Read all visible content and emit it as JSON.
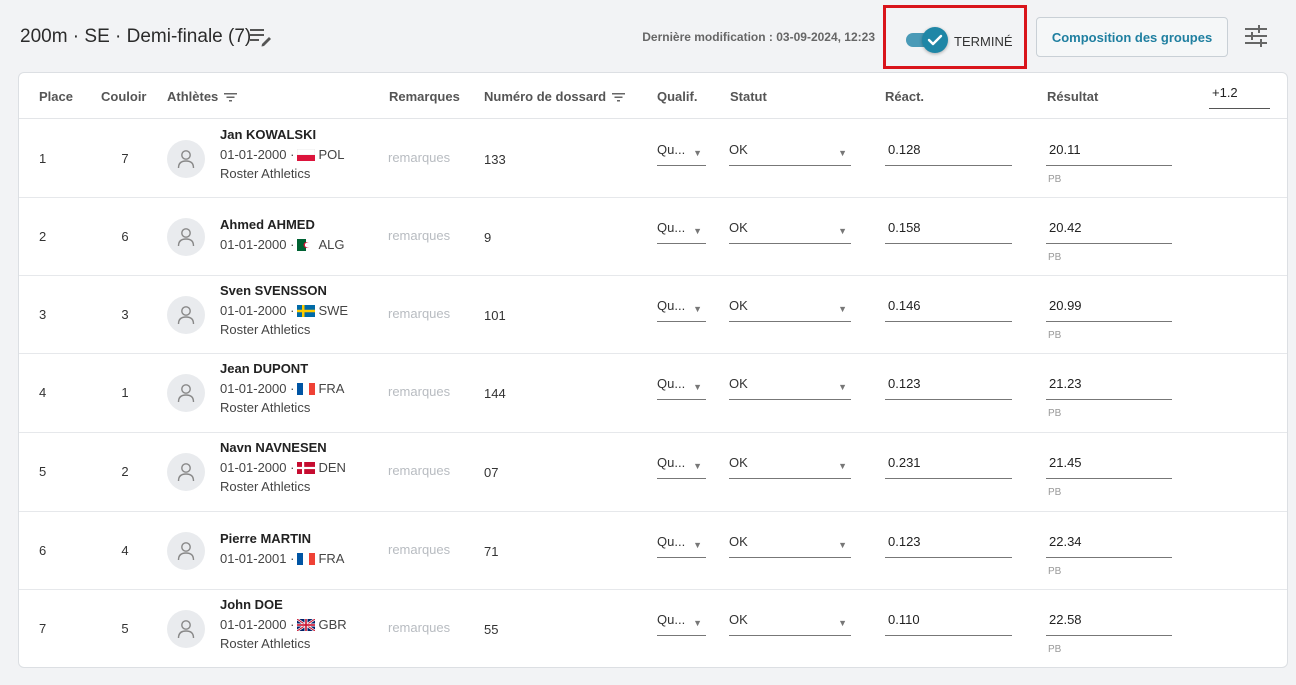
{
  "header": {
    "title": "200m · SE · Demi-finale (7)",
    "last_modified": "Dernière modification : 03-09-2024, 12:23",
    "status_label": "TERMINÉ",
    "compose_button": "Composition des groupes",
    "accent_color": "#1f86a6",
    "highlight_color": "#d9141b"
  },
  "columns": {
    "place": "Place",
    "lane": "Couloir",
    "athletes": "Athlètes",
    "remarks": "Remarques",
    "bib": "Numéro de dossard",
    "qualif": "Qualif.",
    "status": "Statut",
    "reaction": "Réact.",
    "result": "Résultat",
    "wind": "+1.2"
  },
  "rows": [
    {
      "place": "1",
      "lane": "7",
      "name": "Jan KOWALSKI",
      "dob": "01-01-2000 ·",
      "country": "POL",
      "club": "Roster Athletics",
      "remark_placeholder": "remarques",
      "bib": "133",
      "qualif": "Qu...",
      "status": "OK",
      "reaction": "0.128",
      "result": "20.11",
      "record": "PB"
    },
    {
      "place": "2",
      "lane": "6",
      "name": "Ahmed AHMED",
      "dob": "01-01-2000 ·",
      "country": "ALG",
      "club": "",
      "remark_placeholder": "remarques",
      "bib": "9",
      "qualif": "Qu...",
      "status": "OK",
      "reaction": "0.158",
      "result": "20.42",
      "record": "PB"
    },
    {
      "place": "3",
      "lane": "3",
      "name": "Sven SVENSSON",
      "dob": "01-01-2000 ·",
      "country": "SWE",
      "club": "Roster Athletics",
      "remark_placeholder": "remarques",
      "bib": "101",
      "qualif": "Qu...",
      "status": "OK",
      "reaction": "0.146",
      "result": "20.99",
      "record": "PB"
    },
    {
      "place": "4",
      "lane": "1",
      "name": "Jean DUPONT",
      "dob": "01-01-2000 ·",
      "country": "FRA",
      "club": "Roster Athletics",
      "remark_placeholder": "remarques",
      "bib": "144",
      "qualif": "Qu...",
      "status": "OK",
      "reaction": "0.123",
      "result": "21.23",
      "record": "PB"
    },
    {
      "place": "5",
      "lane": "2",
      "name": "Navn NAVNESEN",
      "dob": "01-01-2000 ·",
      "country": "DEN",
      "club": "Roster Athletics",
      "remark_placeholder": "remarques",
      "bib": "07",
      "qualif": "Qu...",
      "status": "OK",
      "reaction": "0.231",
      "result": "21.45",
      "record": "PB"
    },
    {
      "place": "6",
      "lane": "4",
      "name": "Pierre MARTIN",
      "dob": "01-01-2001 ·",
      "country": "FRA",
      "club": "",
      "remark_placeholder": "remarques",
      "bib": "71",
      "qualif": "Qu...",
      "status": "OK",
      "reaction": "0.123",
      "result": "22.34",
      "record": "PB"
    },
    {
      "place": "7",
      "lane": "5",
      "name": "John DOE",
      "dob": "01-01-2000 ·",
      "country": "GBR",
      "club": "Roster Athletics",
      "remark_placeholder": "remarques",
      "bib": "55",
      "qualif": "Qu...",
      "status": "OK",
      "reaction": "0.110",
      "result": "22.58",
      "record": "PB"
    }
  ]
}
